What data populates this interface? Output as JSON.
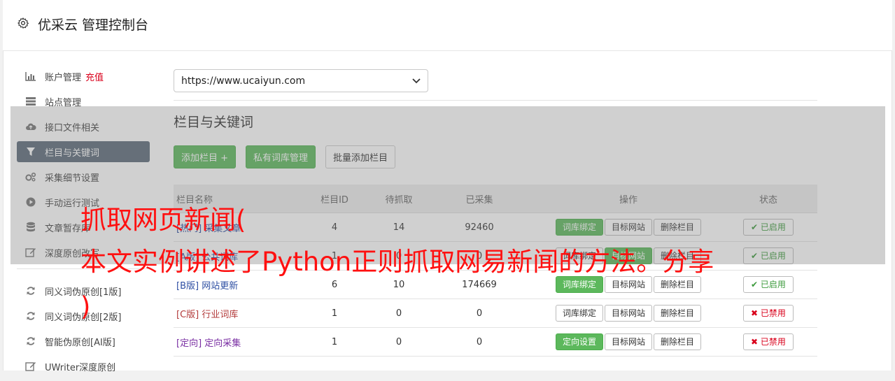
{
  "header": {
    "title": "优采云 管理控制台"
  },
  "sidebar": {
    "items": [
      {
        "label": "账户管理",
        "extra": "充值"
      },
      {
        "label": "站点管理"
      },
      {
        "label": "接口文件相关"
      },
      {
        "label": "栏目与关键词"
      },
      {
        "label": "采集细节设置"
      },
      {
        "label": "手动运行测试"
      },
      {
        "label": "文章暂存库"
      },
      {
        "label": "深度原创改写"
      },
      {
        "label": "同义词伪原创[1版]"
      },
      {
        "label": "同义词伪原创[2版]"
      },
      {
        "label": "智能伪原创[AI版]"
      },
      {
        "label": "UWriter深度原创"
      }
    ]
  },
  "site_select": {
    "value": "https://www.ucaiyun.com"
  },
  "section": {
    "title": "栏目与关键词"
  },
  "buttons": {
    "add_column": "添加栏目 +",
    "private_lib": "私有词库管理",
    "batch_add": "批量添加栏目"
  },
  "table": {
    "headers": [
      "栏目名称",
      "栏目ID",
      "待抓取",
      "已采集",
      "操作",
      "状态"
    ],
    "rows": [
      {
        "tag": "[热门]",
        "name": "采集文章",
        "id": "4",
        "pending": "14",
        "collected": "92460",
        "op1": "词库绑定",
        "op2": "目标网站",
        "op3": "删除栏目",
        "status": "已启用"
      },
      {
        "tag": "[A版]",
        "name": "公共词库",
        "id": "1",
        "pending": "0",
        "collected": "0",
        "op1": "词库绑定",
        "op2": "目标网站",
        "op3": "删除栏目",
        "status": "已启用"
      },
      {
        "tag": "[B版]",
        "name": "网站更新",
        "id": "6",
        "pending": "10",
        "collected": "174669",
        "op1": "词库绑定",
        "op2": "目标网站",
        "op3": "删除栏目",
        "status": "已启用"
      },
      {
        "tag": "[C版]",
        "name": "行业词库",
        "id": "1",
        "pending": "0",
        "collected": "0",
        "op1": "词库绑定",
        "op2": "目标网站",
        "op3": "删除栏目",
        "status": "已禁用"
      },
      {
        "tag": "[定向]",
        "name": "定向采集",
        "id": "1",
        "pending": "0",
        "collected": "0",
        "op1": "定向设置",
        "op2": "目标网站",
        "op3": "删除栏目",
        "status": "已禁用"
      }
    ]
  },
  "overlay": {
    "line1": "抓取网页新闻(",
    "line2": "本文实例讲述了Python正则抓取网易新闻的方法。分享",
    "line3": ")"
  },
  "colors": {
    "accent_green": "#5cb85c",
    "sidebar_active": "#5c6b7a",
    "overlay_text": "#ff1010"
  }
}
